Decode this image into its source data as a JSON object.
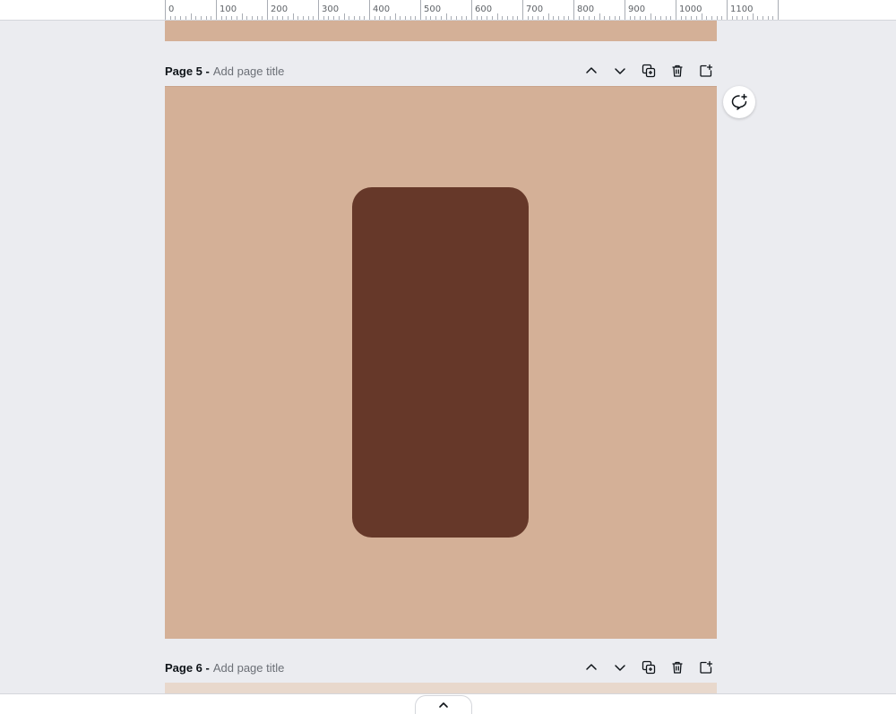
{
  "ruler": {
    "labels": [
      "0",
      "100",
      "200",
      "300",
      "400",
      "500",
      "600",
      "700",
      "800",
      "900",
      "1000",
      "1100"
    ]
  },
  "pages": [
    {
      "label": "Page 5 -",
      "title_placeholder": "Add page title"
    },
    {
      "label": "Page 6 -",
      "title_placeholder": "Add page title"
    }
  ],
  "colors": {
    "page_background": "#d4b097",
    "shape_fill": "#663829",
    "workspace": "#ebecf0"
  },
  "icons": {
    "move_up": "chevron-up-icon",
    "move_down": "chevron-down-icon",
    "duplicate": "duplicate-icon",
    "delete": "trash-icon",
    "add_page": "add-page-icon",
    "comment": "add-comment-icon",
    "expand": "chevron-up-icon"
  }
}
